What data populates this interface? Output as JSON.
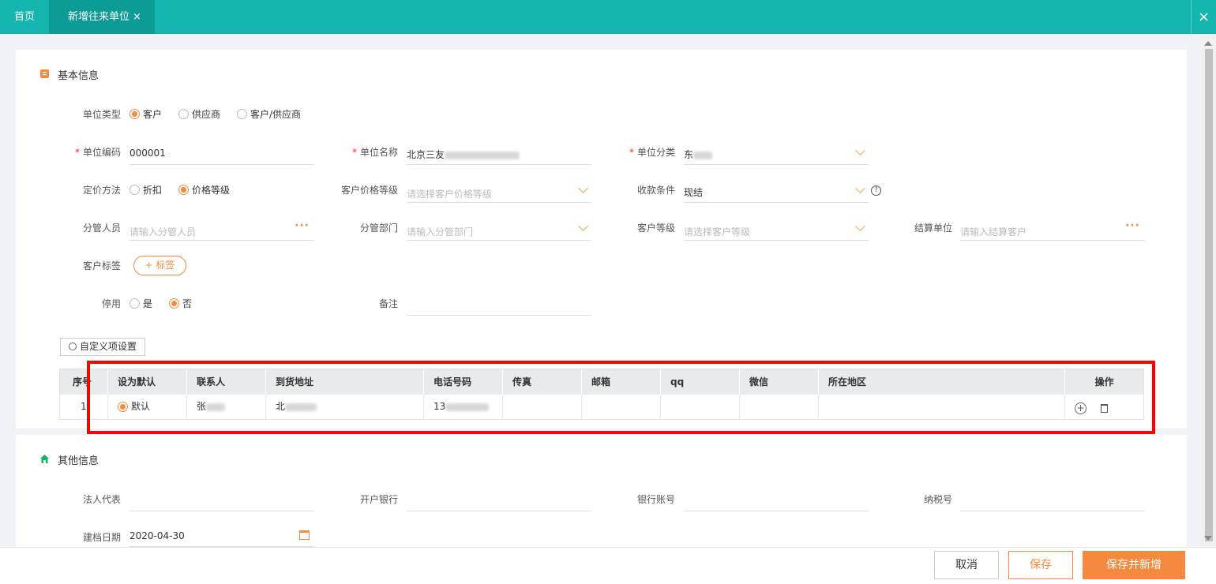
{
  "tabs": {
    "home": "首页",
    "active": "新增往来单位",
    "close": "×",
    "window_close": "×"
  },
  "basic": {
    "title": "基本信息"
  },
  "unit_type": {
    "label": "单位类型",
    "options": [
      "客户",
      "供应商",
      "客户/供应商"
    ],
    "selected": "客户"
  },
  "unit_code": {
    "label": "单位编码",
    "value": "000001"
  },
  "unit_name": {
    "label": "单位名称",
    "value": "北京三友"
  },
  "unit_category": {
    "label": "单位分类",
    "value": "东"
  },
  "pricing": {
    "label": "定价方法",
    "options": [
      "折扣",
      "价格等级"
    ],
    "selected": "价格等级"
  },
  "customer_price_level": {
    "label": "客户价格等级",
    "placeholder": "请选择客户价格等级"
  },
  "payment_terms": {
    "label": "收款条件",
    "value": "现结",
    "help": "?"
  },
  "manager": {
    "label": "分管人员",
    "placeholder": "请输入分管人员",
    "more": "···"
  },
  "department": {
    "label": "分管部门",
    "placeholder": "请输入分管部门"
  },
  "customer_level": {
    "label": "客户等级",
    "placeholder": "请选择客户等级"
  },
  "settlement": {
    "label": "结算单位",
    "placeholder": "请输入结算客户",
    "more": "···"
  },
  "customer_tag": {
    "label": "客户标签",
    "button": "+ 标签"
  },
  "disabled": {
    "label": "停用",
    "options": [
      "是",
      "否"
    ],
    "selected": "否"
  },
  "remark": {
    "label": "备注"
  },
  "custom_button": "自定义项设置",
  "contacts": {
    "headers": [
      "序号",
      "设为默认",
      "联系人",
      "到货地址",
      "电话号码",
      "传真",
      "邮箱",
      "qq",
      "微信",
      "所在地区",
      "操作"
    ],
    "rows": [
      {
        "index": "1",
        "default_label": "默认",
        "contact": "张",
        "address": "北",
        "phone": "13"
      }
    ]
  },
  "other": {
    "title": "其他信息"
  },
  "legal_rep": {
    "label": "法人代表"
  },
  "bank": {
    "label": "开户银行"
  },
  "bank_account": {
    "label": "银行账号"
  },
  "tax_no": {
    "label": "纳税号"
  },
  "created_date": {
    "label": "建档日期",
    "value": "2020-04-30"
  },
  "footer": {
    "cancel": "取消",
    "save": "保存",
    "save_new": "保存并新增"
  },
  "colors": {
    "header": "#13b5ae",
    "accent": "#f5893f",
    "highlight": "#ff0000"
  }
}
